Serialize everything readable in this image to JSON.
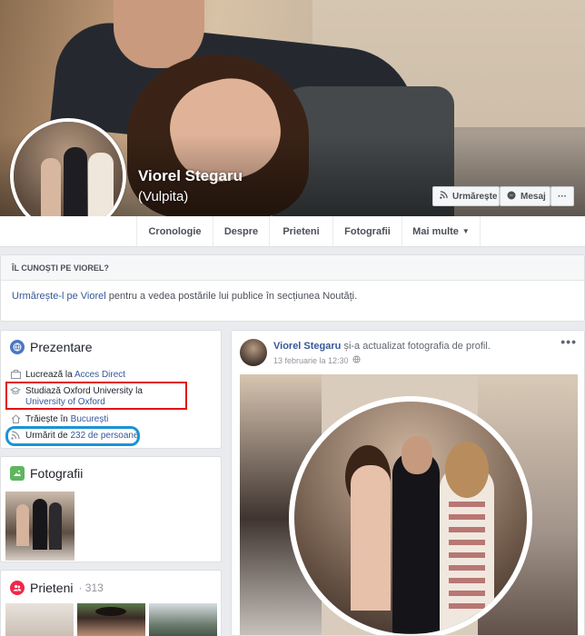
{
  "profile": {
    "name": "Viorel Stegaru",
    "nickname": "(Vulpita)",
    "buttons": {
      "follow": "Urmărește",
      "message": "Mesaj",
      "more": "···"
    }
  },
  "nav": {
    "tabs": [
      {
        "label": "Cronologie"
      },
      {
        "label": "Despre"
      },
      {
        "label": "Prieteni"
      },
      {
        "label": "Fotografii"
      },
      {
        "label": "Mai multe"
      }
    ]
  },
  "know": {
    "heading": "ÎL CUNOȘTI PE VIOREL?",
    "link": "Urmărește-l pe Viorel",
    "text": " pentru a vedea postările lui publice în secțiunea Noutăți."
  },
  "intro": {
    "title": "Prezentare",
    "work_prefix": "Lucrează la ",
    "work_link": "Acces Direct",
    "study_prefix": "Studiază Oxford University la ",
    "study_link": "University of Oxford",
    "live_prefix": "Trăiește în ",
    "live_link": "București",
    "follow_prefix": "Urmărit de ",
    "follow_link": "232 de persoane"
  },
  "photos": {
    "title": "Fotografii"
  },
  "friends": {
    "title": "Prieteni",
    "count": "· 313"
  },
  "post": {
    "author": "Viorel Stegaru",
    "action": " și-a actualizat fotografia de profil.",
    "date": "13 februarie la 12:30",
    "more": "•••"
  },
  "colors": {
    "link": "#365899",
    "highlight_red": "#e30b17",
    "highlight_blue": "#1b93d6"
  },
  "icons": {
    "intro": "globe-icon",
    "work": "briefcase-icon",
    "study": "graduation-cap-icon",
    "live": "home-icon",
    "follow": "rss-icon",
    "photos": "photo-icon",
    "friends": "friends-icon",
    "privacy": "globe-small-icon"
  }
}
